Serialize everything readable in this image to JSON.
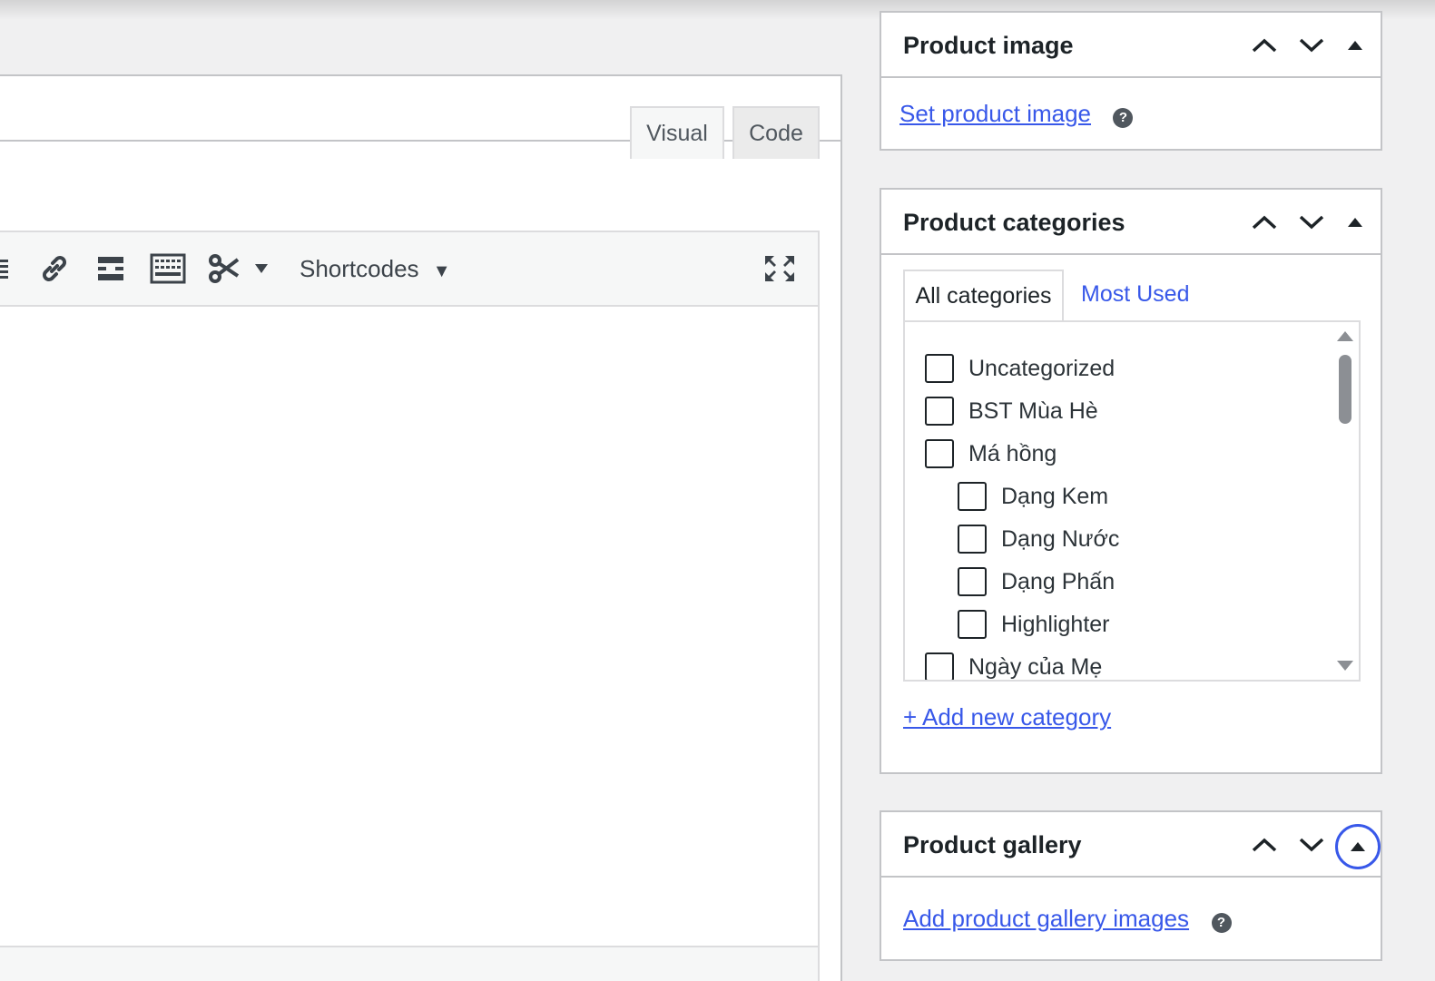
{
  "editor": {
    "tabs": {
      "visual": "Visual",
      "code": "Code"
    },
    "toolbar": {
      "shortcodes_label": "Shortcodes",
      "icons": [
        "list-icon",
        "link-icon",
        "read-more-icon",
        "keyboard-icon",
        "scissors-icon",
        "fullscreen-icon"
      ]
    }
  },
  "sidebar": {
    "product_image": {
      "title": "Product image",
      "link": "Set product image",
      "help": "?"
    },
    "product_categories": {
      "title": "Product categories",
      "tabs": {
        "all": "All categories",
        "most_used": "Most Used"
      },
      "items": [
        {
          "label": "Uncategorized",
          "checked": false,
          "level": 0
        },
        {
          "label": "BST Mùa Hè",
          "checked": false,
          "level": 0
        },
        {
          "label": "Má hồng",
          "checked": false,
          "level": 0
        },
        {
          "label": "Dạng Kem",
          "checked": false,
          "level": 1
        },
        {
          "label": "Dạng Nước",
          "checked": false,
          "level": 1
        },
        {
          "label": "Dạng Phấn",
          "checked": false,
          "level": 1
        },
        {
          "label": "Highlighter",
          "checked": false,
          "level": 1
        },
        {
          "label": "Ngày của Mẹ",
          "checked": false,
          "level": 0
        }
      ],
      "add_new": "+ Add new category"
    },
    "product_gallery": {
      "title": "Product gallery",
      "link": "Add product gallery images",
      "help": "?"
    }
  },
  "colors": {
    "link": "#3858e9",
    "border": "#c3c4c7",
    "background": "#f0f0f1"
  }
}
